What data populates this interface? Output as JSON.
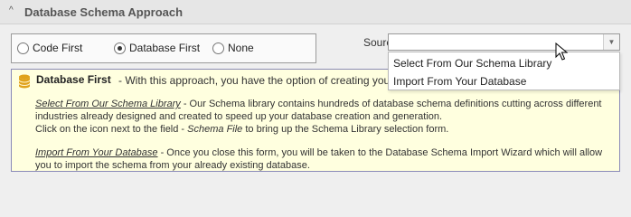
{
  "group": {
    "title": "Database Schema Approach",
    "collapse_glyph": "^"
  },
  "radios": [
    {
      "label": "Code First",
      "checked": false
    },
    {
      "label": "Database First",
      "checked": true
    },
    {
      "label": "None",
      "checked": false
    }
  ],
  "source": {
    "label": "Source:",
    "value": "",
    "options": [
      "Select From Our Schema Library",
      "Import From Your Database"
    ]
  },
  "info": {
    "title": "Database First",
    "intro": "- With this approach, you have the option of creating your sche",
    "p1_link": "Select From Our Schema Library",
    "p1_text1": " - Our Schema library contains hundreds of database schema definitions cutting across different industries already designed and created to speed up your database creation and generation.",
    "p1_text2": "Click on the icon next to the field - ",
    "p1_em": "Schema File",
    "p1_text3": " to bring up the Schema Library selection form.",
    "p2_link": "Import From Your Database",
    "p2_text": " - Once you close this form, you will be taken to the Database Schema Import Wizard which will allow you to import the schema from your already existing database."
  },
  "icons": {
    "database": "database-icon",
    "cursor": "mouse-pointer-icon",
    "dropdown_arrow": "chevron-down-icon",
    "collapse": "chevron-up-icon"
  },
  "colors": {
    "info_background": "#ffffdf",
    "info_border": "#8a8ab8",
    "database_icon": "#e0a21c"
  }
}
